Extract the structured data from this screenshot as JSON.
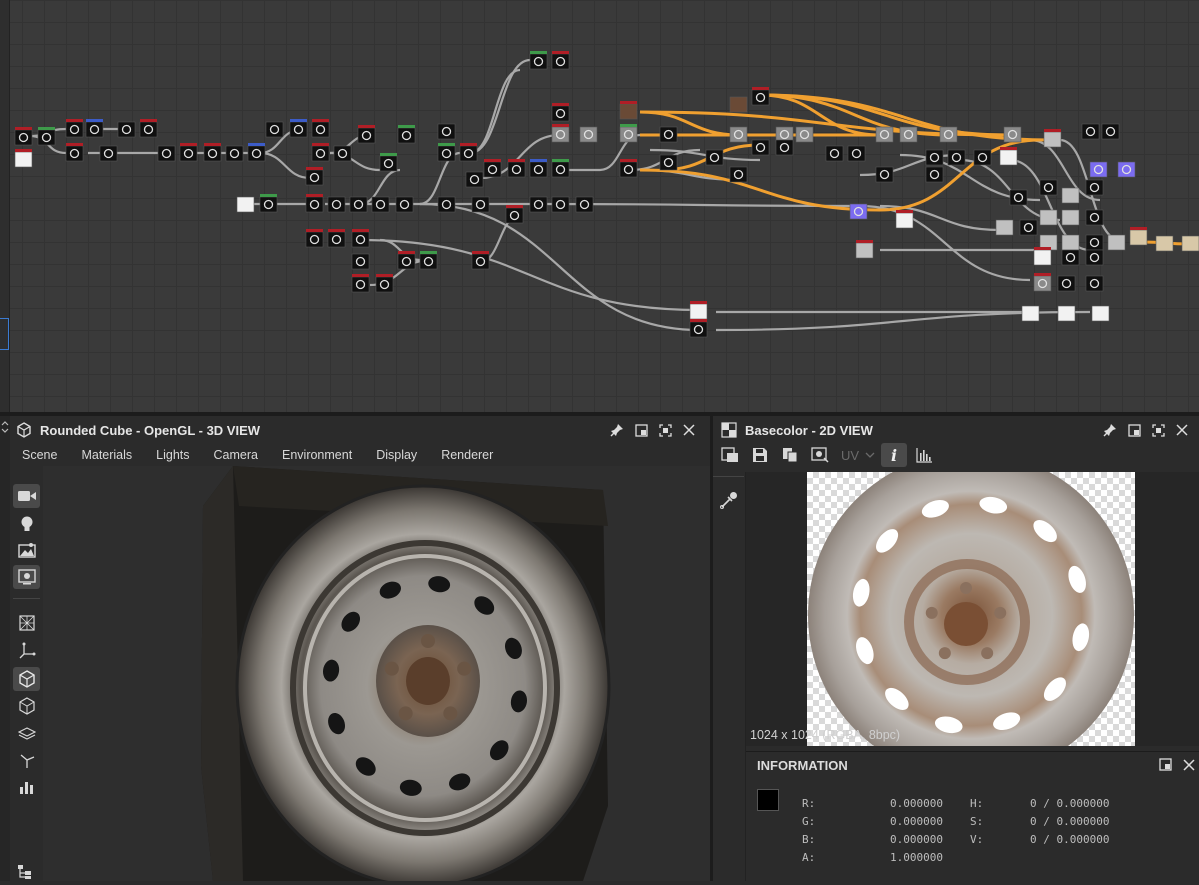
{
  "panel3d": {
    "title": "Rounded Cube - OpenGL - 3D VIEW",
    "menu": [
      "Scene",
      "Materials",
      "Lights",
      "Camera",
      "Environment",
      "Display",
      "Renderer"
    ]
  },
  "panel2d": {
    "title": "Basecolor - 2D VIEW",
    "uv_label": "UV",
    "resolution": "1024 x 1024 (RGBA, 8bpc)"
  },
  "information": {
    "title": "INFORMATION",
    "rows": [
      {
        "k1": "R:",
        "v1": "0.000000",
        "k2": "H:",
        "v2": "0 / 0.000000"
      },
      {
        "k1": "G:",
        "v1": "0.000000",
        "k2": "S:",
        "v2": "0 / 0.000000"
      },
      {
        "k1": "B:",
        "v1": "0.000000",
        "k2": "V:",
        "v2": "0 / 0.000000"
      },
      {
        "k1": "A:",
        "v1": "1.000000",
        "k2": "",
        "v2": ""
      }
    ],
    "swatch_color": "#000000"
  },
  "colors": {
    "accent_orange": "#f0a030",
    "link_gray": "#a8a8a8",
    "selection_blue": "#3b7bd1"
  }
}
